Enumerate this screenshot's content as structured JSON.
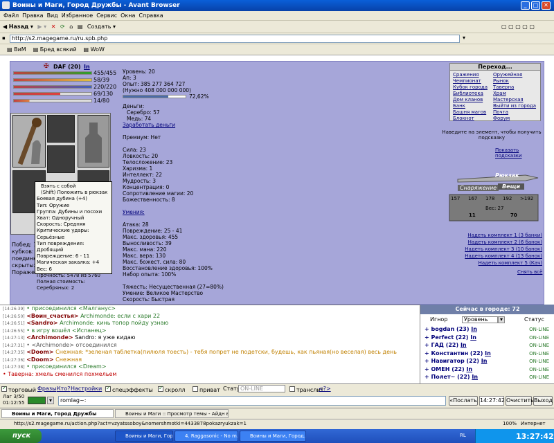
{
  "window": {
    "title": "Воины и Маги, Город Дружбы - Avant Browser"
  },
  "menu": [
    "Файл",
    "Правка",
    "Вид",
    "Избранное",
    "Сервис",
    "Окна",
    "Справка"
  ],
  "toolbar": {
    "back": "Назад",
    "create": "Создать"
  },
  "address": "http://s2.magegame.ru/ru.spb.php",
  "favorites": [
    "ВиМ",
    "Бред всякий",
    "WoW"
  ],
  "character": {
    "name": "DAF (20)",
    "tag": "In",
    "hp": "455/455",
    "mp": "58/39",
    "stat3": "220/220",
    "stat4": "69/130",
    "stat5": "14/80"
  },
  "stats": {
    "level": "Уровень: 20",
    "ap": "Ап: 3",
    "exp": "Опыт: 385 277 364 727",
    "exp_need": "(Нужно 408 000 000 000)",
    "exp_pct": "72,62%",
    "exp_fraction": 0.7262,
    "money": "Деньги:",
    "silver": "Серебро: 57",
    "copper": "Медь: 74",
    "earn": "Заработать деньги",
    "premium": "Премиум: Нет",
    "attrs": [
      "Сила: 23",
      "Ловкость: 20",
      "Телосложение: 23",
      "Харизма: 1",
      "Интеллект: 22",
      "Мудрость: 3",
      "Концентрация: 0",
      "Сопротивление магии: 20",
      "Божественность: 8"
    ],
    "skills_title": "Умения:",
    "combat": [
      "Атака: 28",
      "Повреждение: 25 - 41",
      "Макс. здоровья: 455",
      "Выносливость: 39",
      "Макс. мана: 220",
      "Макс. вера: 130",
      "Макс. божест. сила: 80",
      "Восстановление здоровья: 100%",
      "Набор опыта: 100%"
    ],
    "extra": [
      "Тяжесть: Несущественная (27=80%)",
      "Умение: Великое Мастерство",
      "Скорость: Быстрая"
    ]
  },
  "left_stats": [
    "Побед: 127",
    "кубков: 1",
    "поединко",
    "скрытых с",
    "Поражен"
  ],
  "tooltip": [
    "Взять с собой",
    "(Shift) Положить в рюкзак",
    "Боевая дубина (+4)",
    "Тип: Оружие",
    "Группа: Дубины и посохи",
    "Хват: Одноручный",
    "Скорость: Средняя",
    "Критические удары: Серьёзные",
    "Тип повреждения: Дробящий",
    "Повреждение: 6 - 11",
    "Магическая закалка: +4",
    "Вес: 6",
    "Прочность: 5478 из 5760",
    "Полная стоимость: Серебряных: 2"
  ],
  "nav": {
    "title": "Переход...",
    "items": [
      "Сражения",
      "Оружейная",
      "Чемпионат",
      "Рынок",
      "Кубок города",
      "Таверна",
      "Библиотека",
      "Храм",
      "Дом кланов",
      "Мастерская",
      "Банк",
      "Выйти из города",
      "Башня магов",
      "Почта",
      "Блокнот",
      "Форум"
    ]
  },
  "hint": "Наведите на элемент, чтобы получить подсказку",
  "show_hints": "Показать подсказки",
  "bag": {
    "title": "Рюкзак",
    "equip": "Снаряжение",
    "things": "Вещи",
    "scale": [
      "157",
      "167",
      "178",
      "192",
      ">192"
    ],
    "weight": "Вес: 27",
    "w1": "11",
    "w2": "70"
  },
  "kits": [
    "Надеть комплект 1 (3 банки)",
    "Надеть комплект 2 (6 банок)",
    "Надеть комплект 3 (10 банок)",
    "Надеть комплект 4 (13 банок)",
    "Надеть комплект 5 (Кач)"
  ],
  "undress": "Снять всё",
  "chat": [
    {
      "t": "[14:26:39]",
      "who": "",
      "txt": "• присоединился <Малганус>",
      "c": "#2a7a2a"
    },
    {
      "t": "[14:26:50]",
      "who": "<Воин_счастья>",
      "txt": "Archimonde: если с хари 22",
      "c": "#2a7a2a"
    },
    {
      "t": "[14:26:51]",
      "who": "<Sandro>",
      "txt": "Archimonde: кинь топор пойду узнаю",
      "c": "#2a7a2a"
    },
    {
      "t": "[14:26:55]",
      "who": "",
      "txt": "• в игру вошёл <Испанец>",
      "c": "#2a7a2a"
    },
    {
      "t": "[14:27:13]",
      "who": "<Archimonde>",
      "txt": "Sandro: я уже кидаю",
      "c": "#000"
    },
    {
      "t": "[14:27:31]",
      "who": "",
      "txt": "• <Archimonde> отсоединился",
      "c": "#555"
    },
    {
      "t": "[14:27:35]",
      "who": "<Doom>",
      "txt": "Снежная: *зеленая таблетка(пилюля тоесть) - тебя попрет не подетски, будешь, как пьяная(но веселая) весь день",
      "c": "#c08000"
    },
    {
      "t": "[14:27:36]",
      "who": "<Doom>",
      "txt": "Снежная",
      "c": "#c08000"
    },
    {
      "t": "[14:27:38]",
      "who": "",
      "txt": "• присоединился <Dream>",
      "c": "#2a7a2a"
    },
    {
      "t": "",
      "who": "",
      "txt": "• Таверна: хмель сменился похмельем",
      "c": "#c00000"
    }
  ],
  "online": {
    "title": "Сейчас в городе: 72",
    "sort_label": "Игнор",
    "sort": "Уровень",
    "status_label": "Статус",
    "players": [
      {
        "n": "bogdan (23)",
        "s": "ON-LINE"
      },
      {
        "n": "Perfect (22)",
        "s": "ON-LINE"
      },
      {
        "n": "ГАД (22)",
        "s": "ON-LINE"
      },
      {
        "n": "Константин (22)",
        "s": "ON-LINE"
      },
      {
        "n": "Навигатор (22)",
        "s": "ON-LINE"
      },
      {
        "n": "ОМЕН (22)",
        "s": "ON-LINE"
      },
      {
        "n": "Полет~ (22)",
        "s": "ON-LINE"
      }
    ],
    "tag": "In"
  },
  "options": {
    "trade": "торговый",
    "phrases": "Фразы",
    "who": "Кто?",
    "settings": "Настройки",
    "effects": "спецэффекты",
    "scroll": "скролл",
    "private": "приват",
    "status": "Статус:",
    "status_val": "ON-LINE",
    "translit": "транслит",
    "help": "<?>"
  },
  "msg": {
    "lag": "Лаг 3/50",
    "time": "01:12:55",
    "input": "romlag~:",
    "send": "«Послать",
    "clock": "14:27:42",
    "clear": "Очистить",
    "exit": "Выход"
  },
  "tabs": [
    "Воины и Маги, Город Дружбы",
    "Воины и Маги :: Просмотр темы - Айдн в..."
  ],
  "statusbar": {
    "url": "http://s2.magegame.ru/action.php?act=vzyatssoboy&nomershmotki=4433878pokazryukzak=1",
    "zoom": "100%",
    "zone": "Интернет"
  },
  "taskbar": {
    "start": "пуск",
    "tasks": [
      "Воины и Маги, Город...",
      "4. Raggasonic - No m...",
      "Воины и Маги, Город..."
    ],
    "lang": "RL",
    "clock": "13:27:42"
  },
  "colors": {
    "panel": "#a6a6d9",
    "hp": "#2aa02a",
    "mp": "#4040c0"
  }
}
